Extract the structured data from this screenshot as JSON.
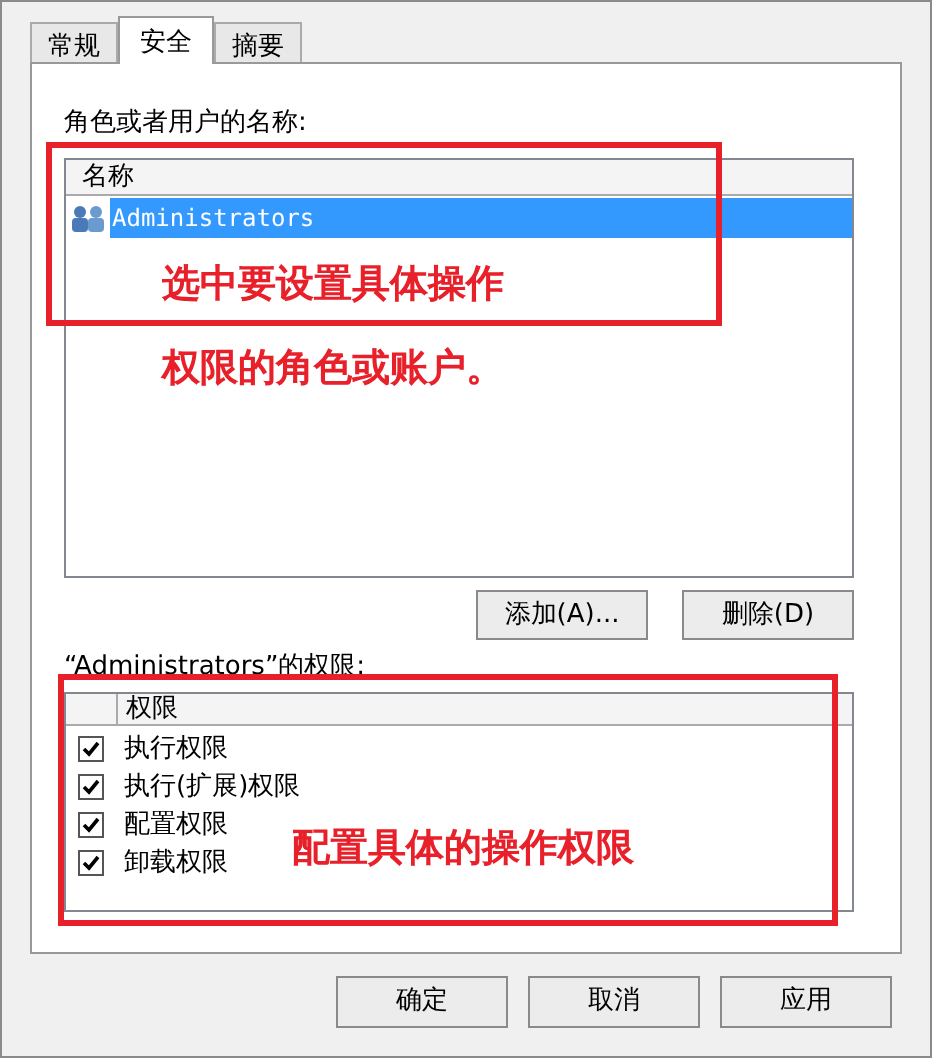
{
  "tabs": [
    {
      "label": "常规",
      "selected": false
    },
    {
      "label": "安全",
      "selected": true
    },
    {
      "label": "摘要",
      "selected": false
    }
  ],
  "principals": {
    "label": "角色或者用户的名称:",
    "column": "名称",
    "items": [
      {
        "name": "Administrators",
        "selected": true
      }
    ],
    "buttons": [
      "添加(A)...",
      "删除(D)"
    ]
  },
  "permissions": {
    "label": "“Administrators”的权限:",
    "column": "权限",
    "items": [
      {
        "name": "执行权限",
        "checked": true
      },
      {
        "name": "执行(扩展)权限",
        "checked": true
      },
      {
        "name": "配置权限",
        "checked": true
      },
      {
        "name": "卸载权限",
        "checked": true
      }
    ]
  },
  "annotations": [
    {
      "lines": [
        "选中要设置具体操作",
        "权限的角色或账户。"
      ]
    },
    {
      "lines": [
        "配置具体的操作权限"
      ]
    }
  ],
  "buttons": [
    "确定",
    "取消",
    "应用"
  ]
}
